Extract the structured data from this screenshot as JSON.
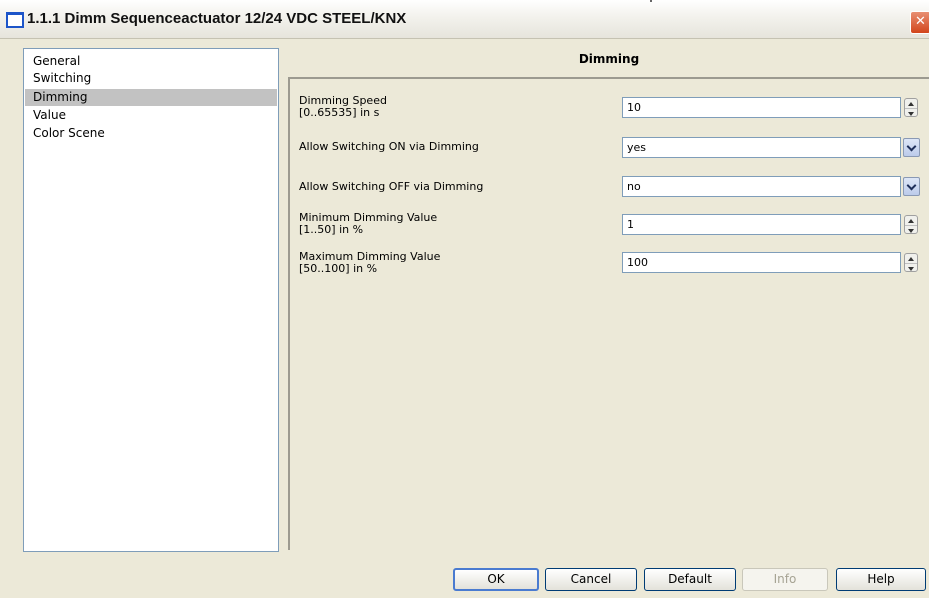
{
  "window": {
    "title": "1.1.1 Dimm Sequenceactuator 12/24 VDC STEEL/KNX",
    "close_glyph": "✕"
  },
  "nav": {
    "items": [
      {
        "label": "General",
        "selected": false
      },
      {
        "label": "Switching",
        "selected": false
      },
      {
        "label": "Dimming",
        "selected": true
      },
      {
        "label": "Value",
        "selected": false
      },
      {
        "label": "Color Scene",
        "selected": false
      }
    ]
  },
  "section": {
    "title": "Dimming"
  },
  "params": [
    {
      "label_line1": "Dimming Speed",
      "label_line2": "[0..65535] in s",
      "value": "10",
      "control": "spinner"
    },
    {
      "label_line1": "Allow Switching ON via Dimming",
      "label_line2": "",
      "value": "yes",
      "control": "dropdown"
    },
    {
      "label_line1": "Allow Switching OFF via Dimming",
      "label_line2": "",
      "value": "no",
      "control": "dropdown"
    },
    {
      "label_line1": "Minimum Dimming Value",
      "label_line2": "[1..50] in %",
      "value": "1",
      "control": "spinner"
    },
    {
      "label_line1": "Maximum Dimming Value",
      "label_line2": "[50..100] in %",
      "value": "100",
      "control": "spinner"
    }
  ],
  "buttons": {
    "ok": "OK",
    "cancel": "Cancel",
    "default": "Default",
    "info": "Info",
    "help": "Help"
  },
  "colors": {
    "background": "#ece9d8",
    "selection": "#c2c2c2",
    "close": "#d2451c"
  }
}
